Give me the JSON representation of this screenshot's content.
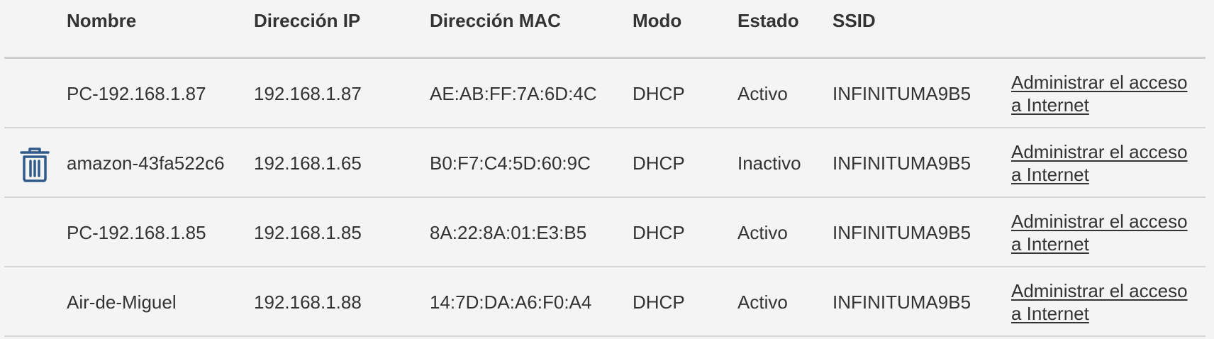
{
  "table": {
    "headers": {
      "name": "Nombre",
      "ip": "Dirección IP",
      "mac": "Dirección MAC",
      "mode": "Modo",
      "state": "Estado",
      "ssid": "SSID"
    },
    "rows": [
      {
        "name": "PC-192.168.1.87",
        "ip": "192.168.1.87",
        "mac": "AE:AB:FF:7A:6D:4C",
        "mode": "DHCP",
        "state": "Activo",
        "ssid": "INFINITUMA9B5",
        "link": "Administrar el acceso a Internet"
      },
      {
        "name": "amazon-43fa522c6",
        "ip": "192.168.1.65",
        "mac": "B0:F7:C4:5D:60:9C",
        "mode": "DHCP",
        "state": "Inactivo",
        "ssid": "INFINITUMA9B5",
        "link": "Administrar el acceso a Internet",
        "delete_icon": "trash-icon"
      },
      {
        "name": "PC-192.168.1.85",
        "ip": "192.168.1.85",
        "mac": "8A:22:8A:01:E3:B5",
        "mode": "DHCP",
        "state": "Activo",
        "ssid": "INFINITUMA9B5",
        "link": "Administrar el acceso a Internet"
      },
      {
        "name": "Air-de-Miguel",
        "ip": "192.168.1.88",
        "mac": "14:7D:DA:A6:F0:A4",
        "mode": "DHCP",
        "state": "Activo",
        "ssid": "INFINITUMA9B5",
        "link": "Administrar el acceso a Internet"
      }
    ]
  },
  "colors": {
    "text": "#333333",
    "background": "#f4f4f4",
    "icon": "#2f5a8c",
    "divider": "#d6d6d6"
  }
}
